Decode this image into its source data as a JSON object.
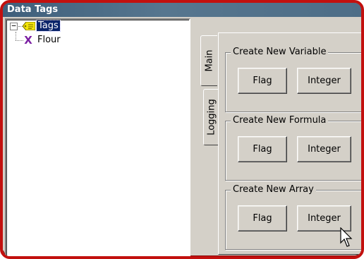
{
  "window": {
    "title": "Data Tags"
  },
  "tree": {
    "expander_symbol": "−",
    "root": {
      "label": "Tags",
      "icon": "tag-icon"
    },
    "children": [
      {
        "label": "Flour",
        "icon": "variable-x-icon"
      }
    ]
  },
  "tabs": [
    {
      "label": "Main",
      "selected": true
    },
    {
      "label": "Logging",
      "selected": false
    }
  ],
  "groups": {
    "variable": {
      "label": "Create New Variable",
      "flag": "Flag",
      "integer": "Integer"
    },
    "formula": {
      "label": "Create New Formula",
      "flag": "Flag",
      "integer": "Integer"
    },
    "array": {
      "label": "Create New Array",
      "flag": "Flag",
      "integer": "Integer"
    }
  },
  "colors": {
    "frame": "#c2100e",
    "titlebar": "#4d6d87",
    "selection": "#0a246a",
    "face": "#d4d0c8"
  }
}
